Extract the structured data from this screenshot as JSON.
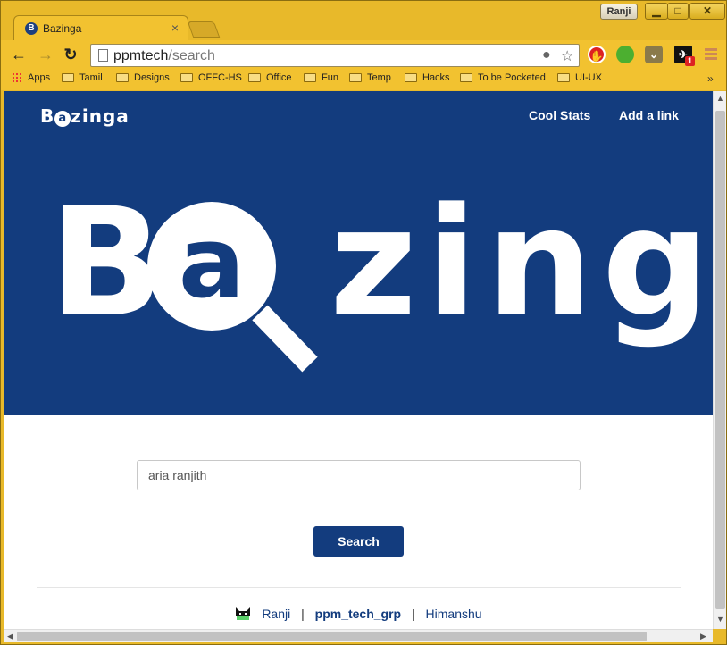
{
  "browser": {
    "tab_title": "Bazinga",
    "tab_close": "×",
    "user_badge": "Ranji",
    "window_controls": {
      "minimize": "▁",
      "maximize": "□",
      "close": "✕"
    },
    "url_host": "ppmtech",
    "url_path": "/search",
    "bookmarks": [
      "Apps",
      "Tamil",
      "Designs",
      "OFFC-HS",
      "Office",
      "Fun",
      "Temp",
      "Hacks",
      "To be Pocketed",
      "UI-UX"
    ],
    "bookmarks_more": "»",
    "extension_badge": "1"
  },
  "site": {
    "brand_prefix": "B",
    "brand_ring": "a",
    "brand_suffix": "zinga",
    "nav": {
      "cool_stats": "Cool Stats",
      "add_link": "Add a link"
    },
    "hero_prefix": "B",
    "hero_ring": "a",
    "hero_suffix": "zinga"
  },
  "search": {
    "value": "aria ranjith",
    "button_label": "Search"
  },
  "footer": {
    "user": "Ranji",
    "group": "ppm_tech_grp",
    "other": "Himanshu",
    "separator": "|"
  },
  "colors": {
    "brand_blue": "#133c7e",
    "chrome_yellow": "#f2c230"
  }
}
